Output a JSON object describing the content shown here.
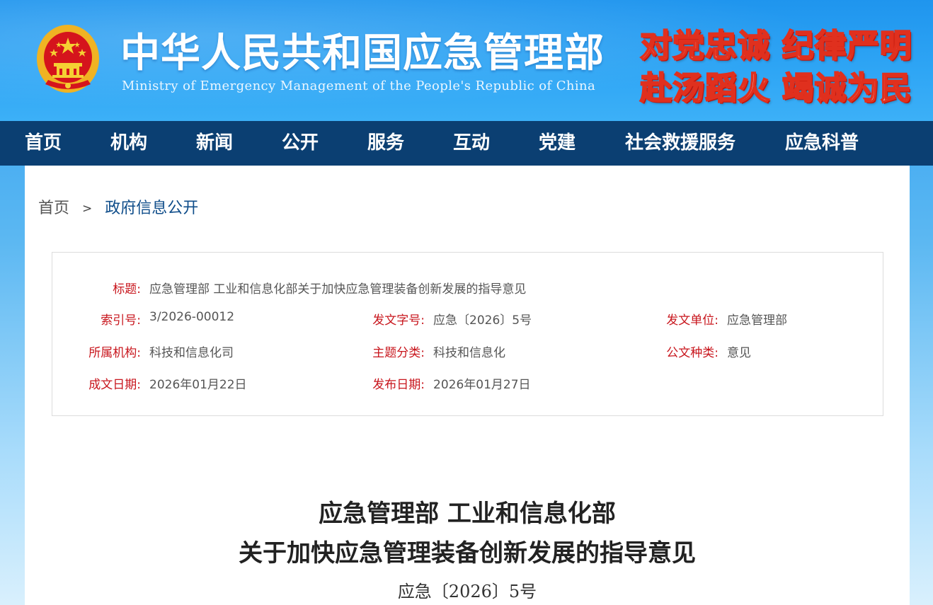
{
  "header": {
    "title": "中华人民共和国应急管理部",
    "subtitle": "Ministry of Emergency Management of the People's Republic of China",
    "slogan_line1": "对党忠诚  纪律严明",
    "slogan_line2": "赴汤蹈火  竭诚为民",
    "emblem_icon": "national-emblem-icon"
  },
  "nav": {
    "items": [
      {
        "label": "首页"
      },
      {
        "label": "机构"
      },
      {
        "label": "新闻"
      },
      {
        "label": "公开"
      },
      {
        "label": "服务"
      },
      {
        "label": "互动"
      },
      {
        "label": "党建"
      },
      {
        "label": "社会救援服务"
      },
      {
        "label": "应急科普"
      }
    ]
  },
  "breadcrumb": {
    "home": "首页",
    "separator": ">",
    "current": "政府信息公开"
  },
  "info": {
    "title_label": "标题:",
    "title_value": "应急管理部 工业和信息化部关于加快应急管理装备创新发展的指导意见",
    "index_label": "索引号:",
    "index_value": "3/2026-00012",
    "docno_label": "发文字号:",
    "docno_value": "应急〔2026〕5号",
    "issuer_label": "发文单位:",
    "issuer_value": "应急管理部",
    "org_label": "所属机构:",
    "org_value": "科技和信息化司",
    "topic_label": "主题分类:",
    "topic_value": "科技和信息化",
    "type_label": "公文种类:",
    "type_value": "意见",
    "created_label": "成文日期:",
    "created_value": "2026年01月22日",
    "published_label": "发布日期:",
    "published_value": "2026年01月27日"
  },
  "document": {
    "title_line1": "应急管理部  工业和信息化部",
    "title_line2": "关于加快应急管理装备创新发展的指导意见",
    "number": "应急〔2026〕5号"
  },
  "colors": {
    "nav_bg": "#0b3f72",
    "label_red": "#c8161d",
    "header_blue": "#2fa6f5"
  }
}
